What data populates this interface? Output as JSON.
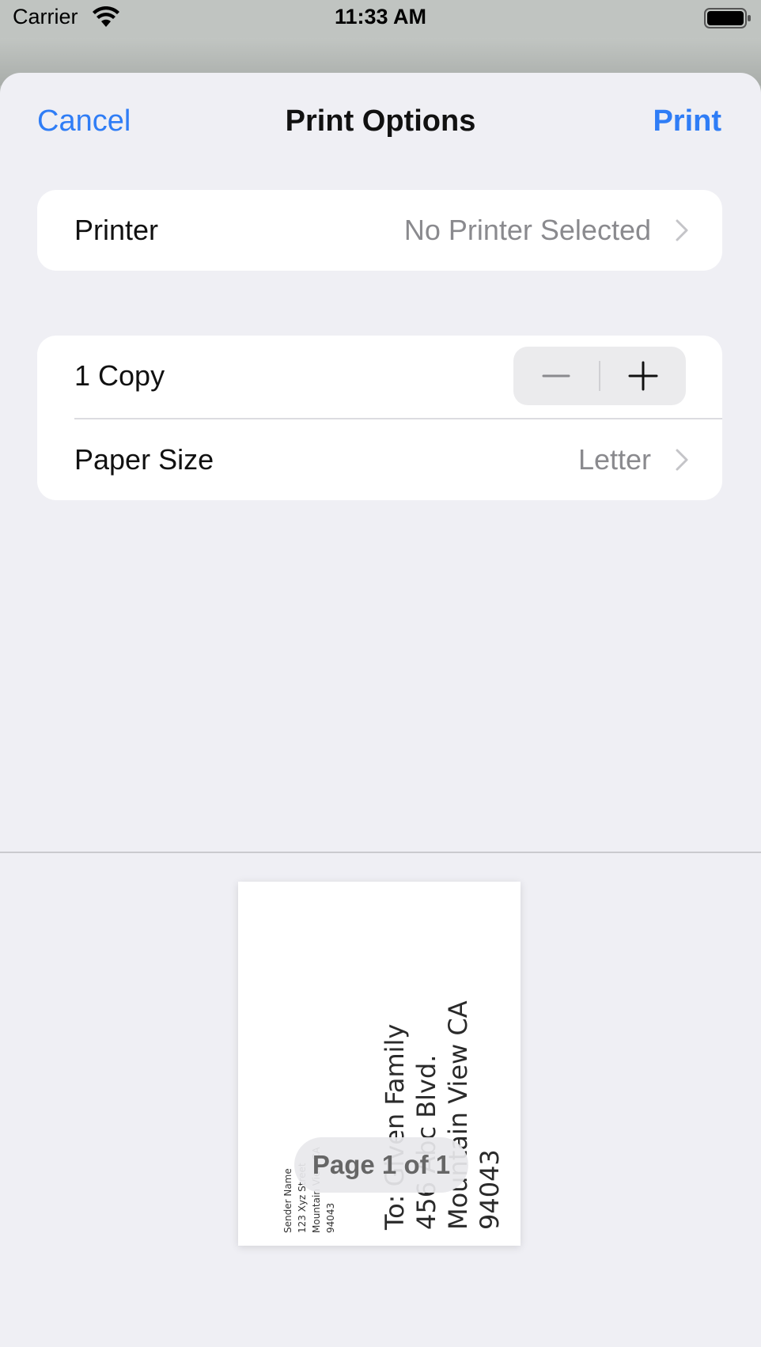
{
  "status_bar": {
    "carrier": "Carrier",
    "time": "11:33 AM"
  },
  "nav": {
    "cancel_label": "Cancel",
    "title": "Print Options",
    "print_label": "Print"
  },
  "printer_row": {
    "label": "Printer",
    "value": "No Printer Selected"
  },
  "copies_row": {
    "label": "1 Copy"
  },
  "paper_row": {
    "label": "Paper Size",
    "value": "Letter"
  },
  "preview": {
    "address_lines": [
      "To: Given Family",
      "456 Abc Blvd.",
      "Mountain View CA",
      "94043"
    ],
    "sender_lines": [
      "Sender Name",
      "123 Xyz Street",
      "Mountain View CA",
      "94043"
    ],
    "page_indicator": "Page 1 of 1"
  },
  "colors": {
    "accent": "#2f7df6",
    "sheet_background": "#efeff4",
    "secondary_text": "#8a8a8e"
  }
}
